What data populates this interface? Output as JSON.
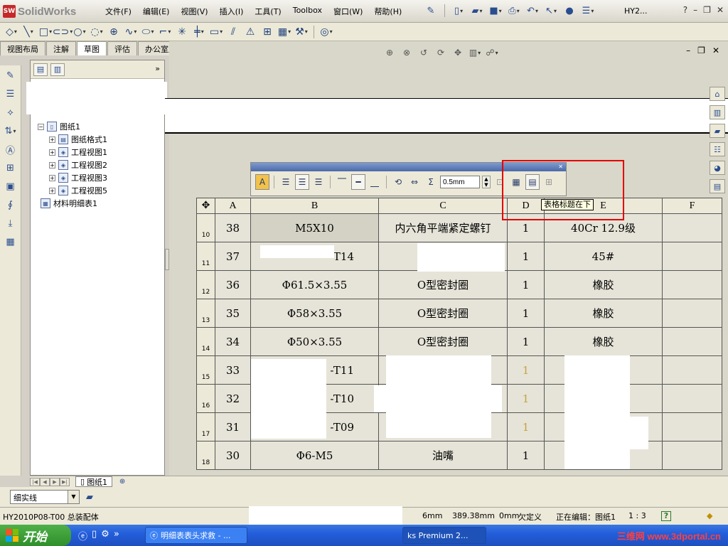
{
  "app": {
    "logo_text": "SolidWorks",
    "logo_mark": "SW"
  },
  "menu": [
    "文件(F)",
    "编辑(E)",
    "视图(V)",
    "插入(I)",
    "工具(T)",
    "Toolbox",
    "窗口(W)",
    "帮助(H)"
  ],
  "doc_short_name": "HY2...",
  "command_tabs": [
    "视图布局",
    "注解",
    "草图",
    "评估",
    "办公室产品"
  ],
  "tree": {
    "items": [
      {
        "label": "图纸1",
        "level": 0,
        "expanded": true
      },
      {
        "label": "图纸格式1",
        "level": 1
      },
      {
        "label": "工程视图1",
        "level": 1
      },
      {
        "label": "工程视图2",
        "level": 1
      },
      {
        "label": "工程视图3",
        "level": 1
      },
      {
        "label": "工程视图5",
        "level": 1
      },
      {
        "label": "材料明细表1",
        "level": 0
      }
    ]
  },
  "format_toolbar": {
    "line_width_value": "0.5mm"
  },
  "tooltip": "表格标题在下",
  "bom": {
    "headers": [
      "A",
      "B",
      "C",
      "D",
      "E",
      "F"
    ],
    "rows": [
      {
        "row": "10",
        "a": "38",
        "b": "M5X10",
        "c": "内六角平端紧定螺钉",
        "d": "1",
        "e": "40Cr 12.9级",
        "f": ""
      },
      {
        "row": "11",
        "a": "37",
        "b": "T14",
        "c": "",
        "d": "1",
        "e": "45#",
        "f": ""
      },
      {
        "row": "12",
        "a": "36",
        "b": "Φ61.5×3.55",
        "c": "O型密封圈",
        "d": "1",
        "e": "橡胶",
        "f": ""
      },
      {
        "row": "13",
        "a": "35",
        "b": "Φ58×3.55",
        "c": "O型密封圈",
        "d": "1",
        "e": "橡胶",
        "f": ""
      },
      {
        "row": "14",
        "a": "34",
        "b": "Φ50×3.55",
        "c": "O型密封圈",
        "d": "1",
        "e": "橡胶",
        "f": ""
      },
      {
        "row": "15",
        "a": "33",
        "b": "-T11",
        "c": "",
        "d": "1",
        "e": "",
        "f": ""
      },
      {
        "row": "16",
        "a": "32",
        "b": "-T10",
        "c": "",
        "d": "1",
        "e": "",
        "f": ""
      },
      {
        "row": "17",
        "a": "31",
        "b": "-T09",
        "c": "",
        "d": "1",
        "e": "",
        "f": ""
      },
      {
        "row": "18",
        "a": "30",
        "b": "Φ6-M5",
        "c": "油嘴",
        "d": "1",
        "e": "",
        "f": ""
      }
    ]
  },
  "sheet_tab": "图纸1",
  "line_type": "细实线",
  "status": {
    "doc": "HY2010P08-T00 总装配体",
    "x": "6mm",
    "y": "389.38mm",
    "z": "0mm",
    "define": "欠定义",
    "editing": "正在编辑：图纸1",
    "scale": "1 : 3"
  },
  "taskbar": {
    "start": "开始",
    "task1": "明细表表头求救 - ...",
    "task2": "ks Premium 2...",
    "brand": "三维网 www.3dportal.cn"
  },
  "colors": {
    "highlight": "#e30000",
    "qty_dim": "#c8a040",
    "taskbar": "#245edb"
  }
}
